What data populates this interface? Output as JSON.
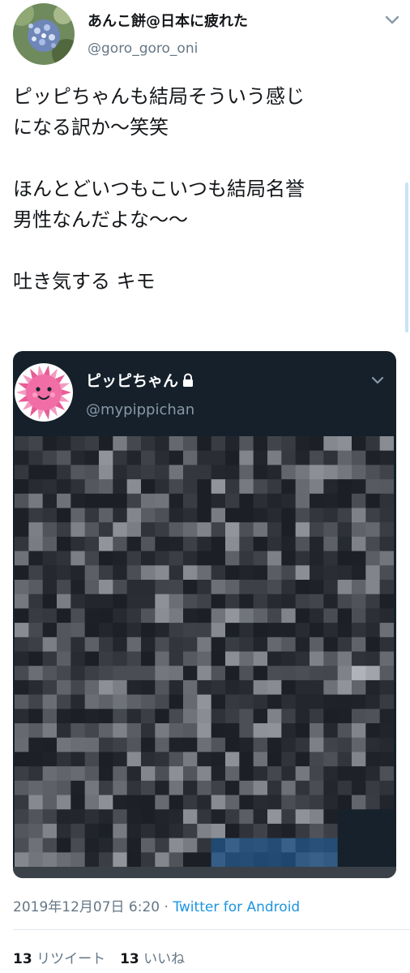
{
  "tweet": {
    "display_name": "あんこ餅@日本に疲れた",
    "handle": "@goro_goro_oni",
    "avatar_icon": "hydrangea-avatar",
    "menu_icon": "chevron-down-icon",
    "text_paragraphs": [
      [
        "ピッピちゃんも結局そういう感じ",
        "になる訳か〜笑笑"
      ],
      [
        "ほんとどいつもこいつも結局名誉",
        "男性なんだよな〜〜"
      ],
      [
        "吐き気する キモ"
      ]
    ],
    "timestamp": "2019年12月07日 6:20",
    "separator": " · ",
    "source": "Twitter for Android",
    "stats": {
      "retweets_count": "13",
      "retweets_label": "リツイート",
      "likes_count": "13",
      "likes_label": "いいね"
    }
  },
  "quoted_tweet": {
    "display_name": "ピッピちゃん",
    "handle": "@mypippichan",
    "protected_icon": "lock-icon",
    "avatar_icon": "pink-sun-face-avatar",
    "menu_icon": "chevron-down-icon",
    "content_state": "pixelated"
  },
  "colors": {
    "link": "#1b95e0",
    "card_background": "#15202b",
    "text": "#14171a",
    "secondary": "#657786"
  }
}
